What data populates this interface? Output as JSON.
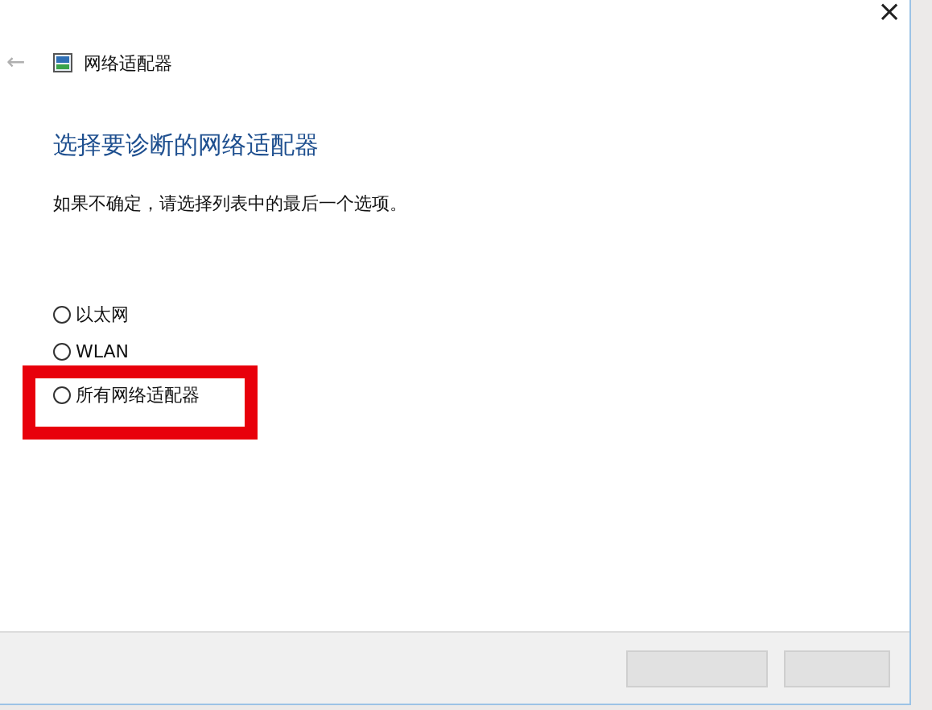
{
  "window": {
    "close": "×"
  },
  "header": {
    "back": "←",
    "title": "网络适配器"
  },
  "heading": "选择要诊断的网络适配器",
  "instruction": "如果不确定，请选择列表中的最后一个选项。",
  "options": [
    {
      "label": "以太网",
      "selected": false,
      "highlighted": false
    },
    {
      "label": "WLAN",
      "selected": false,
      "highlighted": false
    },
    {
      "label": "所有网络适配器",
      "selected": false,
      "highlighted": true
    }
  ],
  "footer": {
    "buttons": [
      {
        "kind": "blank"
      },
      {
        "kind": "blank"
      }
    ]
  }
}
